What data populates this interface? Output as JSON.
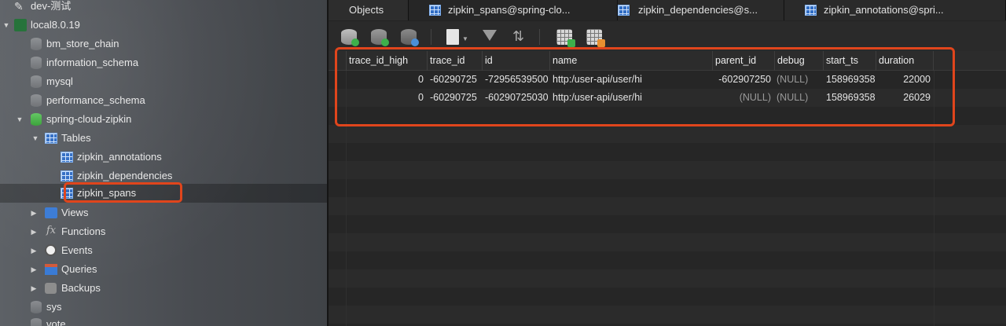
{
  "sidebar": {
    "items": [
      {
        "label": "dev-测试",
        "icon": "connection-icon"
      },
      {
        "label": "local8.0.19",
        "icon": "connection-icon"
      },
      {
        "label": "bm_store_chain",
        "icon": "database-icon"
      },
      {
        "label": "information_schema",
        "icon": "database-icon"
      },
      {
        "label": "mysql",
        "icon": "database-icon"
      },
      {
        "label": "performance_schema",
        "icon": "database-icon"
      },
      {
        "label": "spring-cloud-zipkin",
        "icon": "database-icon"
      },
      {
        "label": "Tables",
        "icon": "tables-icon"
      },
      {
        "label": "zipkin_annotations",
        "icon": "table-icon"
      },
      {
        "label": "zipkin_dependencies",
        "icon": "table-icon"
      },
      {
        "label": "zipkin_spans",
        "icon": "table-icon"
      },
      {
        "label": "Views",
        "icon": "views-icon"
      },
      {
        "label": "Functions",
        "icon": "functions-icon"
      },
      {
        "label": "Events",
        "icon": "events-icon"
      },
      {
        "label": "Queries",
        "icon": "queries-icon"
      },
      {
        "label": "Backups",
        "icon": "backups-icon"
      },
      {
        "label": "sys",
        "icon": "database-icon"
      },
      {
        "label": "vote",
        "icon": "database-icon"
      }
    ]
  },
  "tabs": [
    {
      "label": "Objects"
    },
    {
      "label": "zipkin_spans@spring-clo..."
    },
    {
      "label": "zipkin_dependencies@s..."
    },
    {
      "label": "zipkin_annotations@spri..."
    }
  ],
  "toolbar": {
    "buttons": [
      "add-record-icon",
      "save-record-icon",
      "refresh-icon",
      "text-icon",
      "filter-icon",
      "sort-icon",
      "import-icon",
      "export-icon"
    ]
  },
  "grid": {
    "columns": [
      "trace_id_high",
      "trace_id",
      "id",
      "name",
      "parent_id",
      "debug",
      "start_ts",
      "duration"
    ],
    "rows": [
      [
        "0",
        "-60290725",
        "-72956539500",
        "http:/user-api/user/hi",
        "-602907250",
        "(NULL)",
        "158969358",
        "22000"
      ],
      [
        "0",
        "-60290725",
        "-60290725030",
        "http:/user-api/user/hi",
        "(NULL)",
        "(NULL)",
        "158969358",
        "26029"
      ]
    ]
  },
  "colors": {
    "highlight": "#e0451c",
    "accent": "#3a7bd5"
  }
}
